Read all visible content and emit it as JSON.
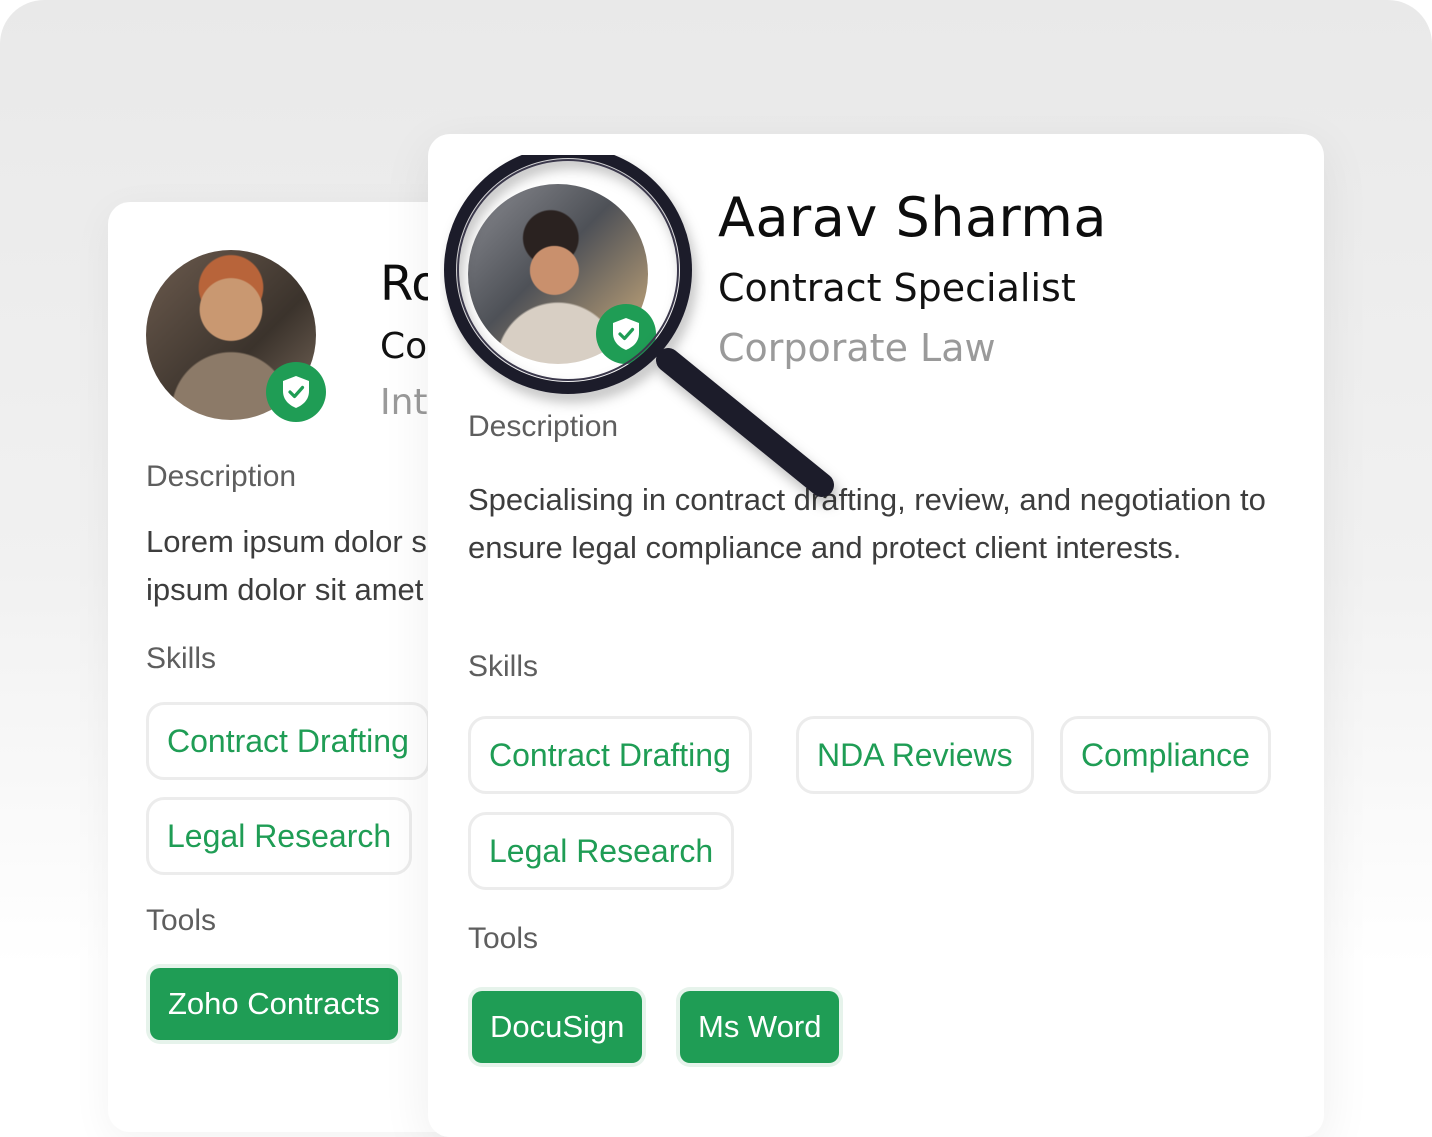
{
  "back_card": {
    "name": "Ro",
    "role": "Co",
    "dept": "Int",
    "description_label": "Description",
    "description": "Lorem ipsum dolor s ipsum dolor sit amet",
    "skills_label": "Skills",
    "skills": [
      "Contract Drafting",
      "Legal Research"
    ],
    "tools_label": "Tools",
    "tools": [
      "Zoho Contracts"
    ]
  },
  "front_card": {
    "name": "Aarav Sharma",
    "role": "Contract Specialist",
    "dept": "Corporate Law",
    "description_label": "Description",
    "description": "Specialising in contract drafting, review, and negotiation to ensure legal compliance and protect client interests.",
    "skills_label": "Skills",
    "skills": [
      "Contract Drafting",
      "NDA Reviews",
      "Compliance",
      "Legal Research"
    ],
    "tools_label": "Tools",
    "tools": [
      "DocuSign",
      "Ms Word"
    ]
  },
  "icons": {
    "verified_badge": "shield-check-icon",
    "magnifier": "magnifying-glass-icon"
  },
  "colors": {
    "accent": "#1f9d55",
    "chip_border": "#ececec",
    "muted_text": "#9a9a9a"
  }
}
